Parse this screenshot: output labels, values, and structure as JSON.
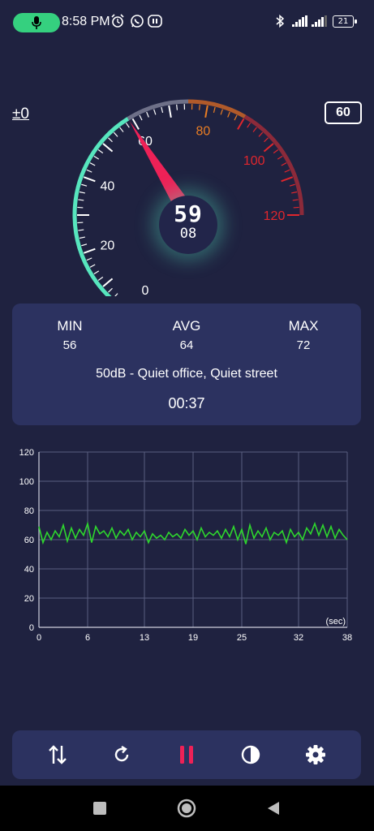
{
  "status_bar": {
    "time": "8:58 PM",
    "battery": "21",
    "icons": [
      "microphone-icon",
      "alarm-icon",
      "whatsapp-icon",
      "notification-icon",
      "bluetooth-icon",
      "signal-icon",
      "battery-icon"
    ]
  },
  "header": {
    "calibration": "±0",
    "threshold": "60"
  },
  "gauge": {
    "scale_labels": [
      "0",
      "20",
      "40",
      "60",
      "80",
      "100",
      "120"
    ],
    "needle_value": 59,
    "reading": "59",
    "reading_decimal": "08",
    "colors": {
      "low": "#57e6be",
      "mid": "#e97d23",
      "high": "#e0262d",
      "needle": "#ee2157"
    }
  },
  "stats": {
    "min_label": "MIN",
    "min_value": "56",
    "avg_label": "AVG",
    "avg_value": "64",
    "max_label": "MAX",
    "max_value": "72",
    "level_description": "50dB - Quiet office, Quiet street",
    "elapsed": "00:37"
  },
  "chart_data": {
    "type": "line",
    "xlabel": "(sec)",
    "ylabel": "",
    "ylim": [
      0,
      120
    ],
    "xlim": [
      0,
      38
    ],
    "y_ticks": [
      "0",
      "20",
      "40",
      "60",
      "80",
      "100",
      "120"
    ],
    "x_ticks": [
      "0",
      "6",
      "13",
      "19",
      "25",
      "32",
      "38"
    ],
    "grid": true,
    "color": "#2ed62e",
    "series": [
      {
        "x": [
          0,
          0.5,
          1,
          1.5,
          2,
          2.5,
          3,
          3.5,
          4,
          4.5,
          5,
          5.5,
          6,
          6.5,
          7,
          7.5,
          8,
          8.5,
          9,
          9.5,
          10,
          10.5,
          11,
          11.5,
          12,
          12.5,
          13,
          13.5,
          14,
          14.5,
          15,
          15.5,
          16,
          16.5,
          17,
          17.5,
          18,
          18.5,
          19,
          19.5,
          20,
          20.5,
          21,
          21.5,
          22,
          22.5,
          23,
          23.5,
          24,
          24.5,
          25,
          25.5,
          26,
          26.5,
          27,
          27.5,
          28,
          28.5,
          29,
          29.5,
          30,
          30.5,
          31,
          31.5,
          32,
          32.5,
          33,
          33.5,
          34,
          34.5,
          35,
          35.5,
          36,
          36.5,
          37,
          37.5,
          38
        ],
        "values": [
          69,
          58,
          65,
          60,
          66,
          62,
          70,
          59,
          68,
          61,
          67,
          63,
          71,
          58,
          69,
          64,
          66,
          62,
          68,
          61,
          66,
          63,
          67,
          60,
          65,
          62,
          66,
          58,
          64,
          61,
          63,
          60,
          65,
          62,
          64,
          61,
          67,
          63,
          66,
          60,
          68,
          62,
          65,
          63,
          66,
          61,
          67,
          62,
          69,
          60,
          67,
          57,
          70,
          61,
          66,
          62,
          68,
          60,
          65,
          63,
          66,
          58,
          67,
          62,
          65,
          60,
          68,
          64,
          71,
          63,
          70,
          62,
          69,
          61,
          67,
          63,
          60
        ]
      }
    ]
  },
  "toolbar": {
    "buttons": [
      "sort-icon",
      "refresh-icon",
      "pause-icon",
      "contrast-icon",
      "settings-icon"
    ]
  },
  "navbar": {
    "buttons": [
      "recents-icon",
      "home-icon",
      "back-icon"
    ]
  }
}
